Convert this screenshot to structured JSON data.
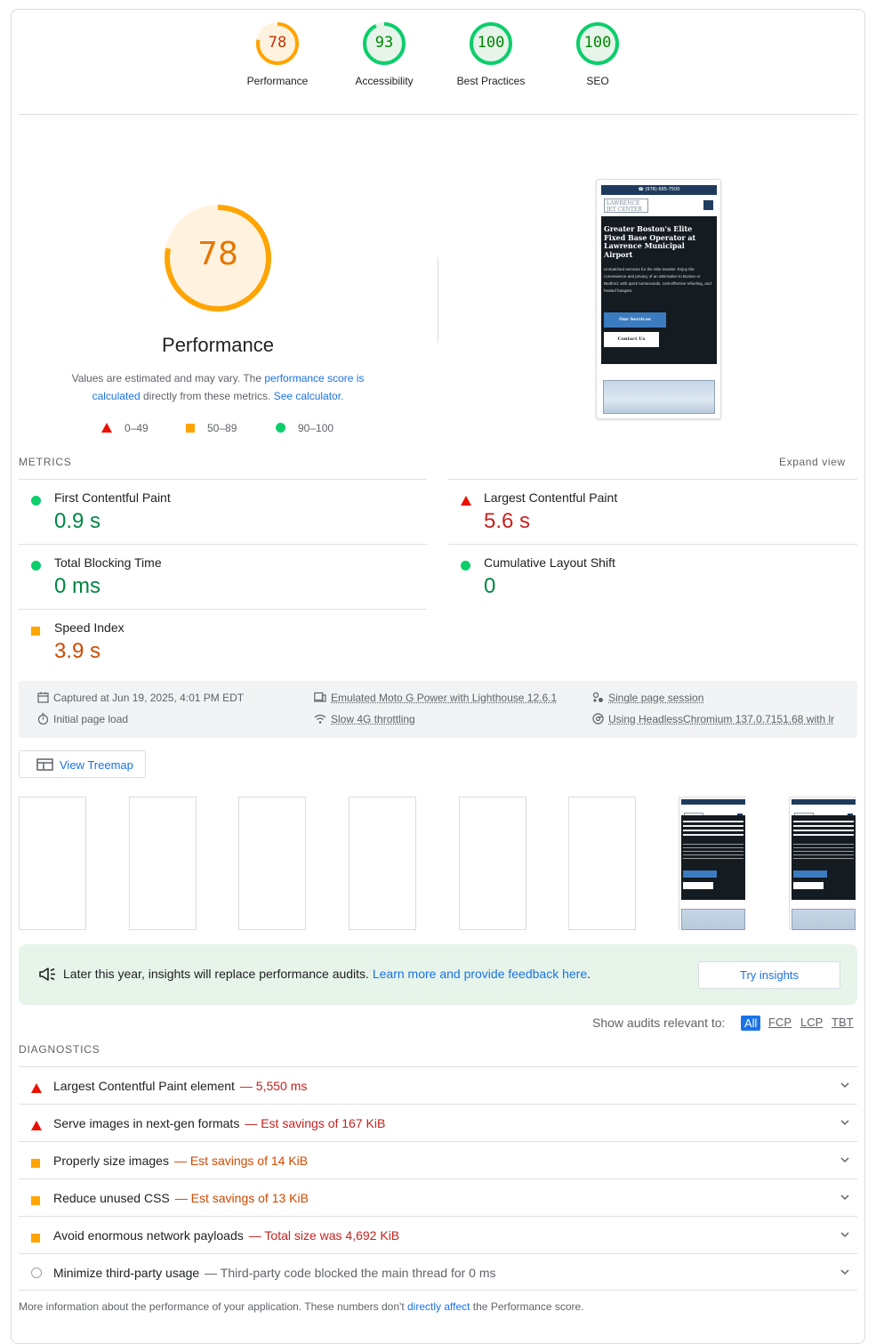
{
  "scores": [
    {
      "label": "Performance",
      "value": "78",
      "score": 78,
      "color": "#ffa400",
      "text": "#c33300",
      "bg": "#fff3e0"
    },
    {
      "label": "Accessibility",
      "value": "93",
      "score": 93,
      "color": "#0cce6b",
      "text": "#008800",
      "bg": "#e6f4ea"
    },
    {
      "label": "Best Practices",
      "value": "100",
      "score": 100,
      "color": "#0cce6b",
      "text": "#008800",
      "bg": "#e6f4ea"
    },
    {
      "label": "SEO",
      "value": "100",
      "score": 100,
      "color": "#0cce6b",
      "text": "#008800",
      "bg": "#e6f4ea"
    }
  ],
  "perf": {
    "score": "78",
    "title": "Performance",
    "desc_pre": "Values are estimated and may vary. The ",
    "desc_link1": "performance score is calculated",
    "desc_mid": " directly from these metrics. ",
    "desc_link2": "See calculator.",
    "legend": {
      "bad": "0–49",
      "average": "50–89",
      "pass": "90–100"
    }
  },
  "phone": {
    "phone_number": "☎ (978) 685-7500",
    "logo": "LAWRENCE JET CENTER",
    "heading": "Greater Boston's Elite Fixed Base Operator at Lawrence Municipal Airport",
    "paragraph": "Unmatched services for the elite traveler. Enjoy the convenience and privacy of an alternative to Boston or Bedford, with quick turnarounds, cost-effective refueling, and heated hangars.",
    "btn_services": "Our Services",
    "btn_contact": "Contact Us"
  },
  "metrics": {
    "heading": "METRICS",
    "expand": "Expand view",
    "items": [
      {
        "name": "First Contentful Paint",
        "value": "0.9 s",
        "status": "pass"
      },
      {
        "name": "Largest Contentful Paint",
        "value": "5.6 s",
        "status": "fail"
      },
      {
        "name": "Total Blocking Time",
        "value": "0 ms",
        "status": "pass"
      },
      {
        "name": "Cumulative Layout Shift",
        "value": "0",
        "status": "pass"
      },
      {
        "name": "Speed Index",
        "value": "3.9 s",
        "status": "average"
      }
    ]
  },
  "env": {
    "captured": "Captured at Jun 19, 2025, 4:01 PM EDT",
    "initial": "Initial page load",
    "device": "Emulated Moto G Power with Lighthouse 12.6.1",
    "throttle": "Slow 4G throttling",
    "session": "Single page session",
    "browser": "Using HeadlessChromium 137.0.7151.68 with lr"
  },
  "treemap": "View Treemap",
  "banner": {
    "text": "Later this year, insights will replace performance audits. ",
    "link": "Learn more and provide feedback here",
    "period": ".",
    "button": "Try insights"
  },
  "filter": {
    "label": "Show audits relevant to:",
    "options": [
      "All",
      "FCP",
      "LCP",
      "TBT"
    ]
  },
  "diagnostics": {
    "heading": "DIAGNOSTICS",
    "items": [
      {
        "title": "Largest Contentful Paint element",
        "detail": "— 5,550 ms",
        "status": "fail"
      },
      {
        "title": "Serve images in next-gen formats",
        "detail": "— Est savings of 167 KiB",
        "status": "fail"
      },
      {
        "title": "Properly size images",
        "detail": "— Est savings of 14 KiB",
        "status": "average"
      },
      {
        "title": "Reduce unused CSS",
        "detail": "— Est savings of 13 KiB",
        "status": "average"
      },
      {
        "title": "Avoid enormous network payloads",
        "detail": "— Total size was 4,692 KiB",
        "status": "average"
      },
      {
        "title": "Minimize third-party usage",
        "detail": "— Third-party code blocked the main thread for 0 ms",
        "status": "info"
      }
    ]
  },
  "footer": {
    "pre": "More information about the performance of your application. These numbers don't ",
    "link": "directly affect",
    "post": " the Performance score."
  }
}
